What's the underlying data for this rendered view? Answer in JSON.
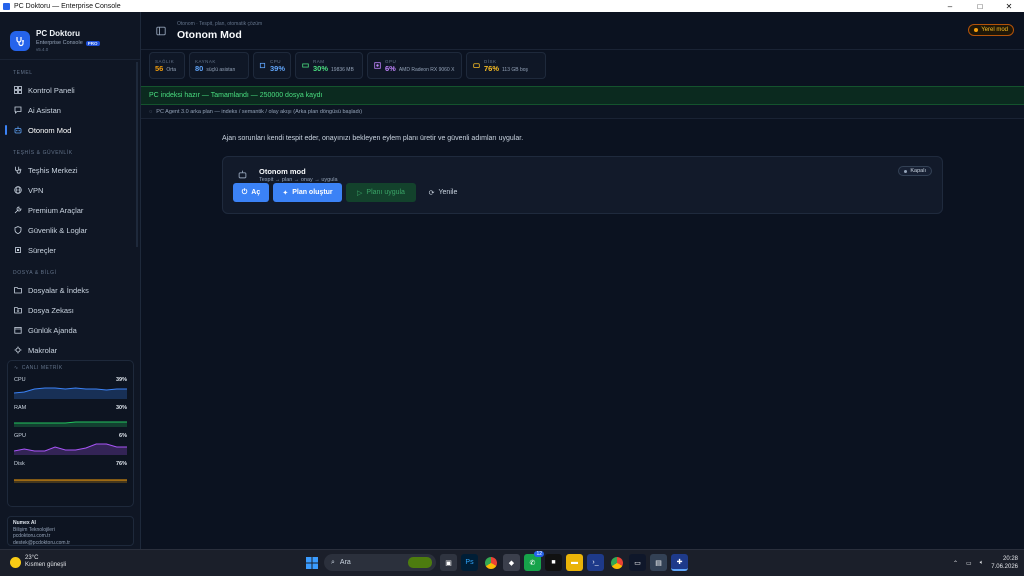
{
  "window": {
    "title": "PC Doktoru — Enterprise Console",
    "controls": [
      "–",
      "□",
      "✕"
    ]
  },
  "brand": {
    "name": "PC Doktoru",
    "subtitle": "Enterprise Console",
    "badge": "PRO",
    "version": "v5.4.0"
  },
  "sidebar": {
    "sections": [
      {
        "label": "TEMEL",
        "items": [
          {
            "label": "Kontrol Paneli",
            "icon": "grid-icon"
          },
          {
            "label": "Ai Asistan",
            "icon": "chat-icon"
          },
          {
            "label": "Otonom Mod",
            "icon": "robot-icon",
            "active": true
          }
        ]
      },
      {
        "label": "TEŞHİS & GÜVENLİK",
        "items": [
          {
            "label": "Teşhis Merkezi",
            "icon": "stethoscope-icon"
          },
          {
            "label": "VPN",
            "icon": "globe-icon"
          },
          {
            "label": "Premium Araçlar",
            "icon": "wrench-icon"
          },
          {
            "label": "Güvenlik & Loglar",
            "icon": "shield-icon"
          },
          {
            "label": "Süreçler",
            "icon": "cpu-icon"
          }
        ]
      },
      {
        "label": "DOSYA & BİLGİ",
        "items": [
          {
            "label": "Dosyalar & İndeks",
            "icon": "folder-icon"
          },
          {
            "label": "Dosya Zekası",
            "icon": "folder-search-icon"
          },
          {
            "label": "Günlük Ajanda",
            "icon": "calendar-icon"
          },
          {
            "label": "Makrolar",
            "icon": "macro-icon"
          }
        ]
      }
    ],
    "metrics": {
      "title": "CANLI METRİK",
      "rows": [
        {
          "label": "CPU",
          "value": "39%",
          "color": "#3b82f6",
          "points": [
            5,
            6,
            9,
            10,
            10,
            9,
            10,
            9,
            9,
            8,
            9,
            9
          ]
        },
        {
          "label": "RAM",
          "value": "30%",
          "color": "#22c55e",
          "points": [
            3,
            3,
            3,
            3,
            3,
            3,
            4,
            4,
            4,
            4,
            4,
            4
          ]
        },
        {
          "label": "GPU",
          "value": "6%",
          "color": "#a855f7",
          "points": [
            3,
            5,
            3,
            3,
            7,
            4,
            4,
            6,
            10,
            10,
            7,
            7
          ]
        },
        {
          "label": "Disk",
          "value": "76%",
          "color": "#f59e0b",
          "points": [
            2,
            2,
            2,
            2,
            2,
            2,
            2,
            2,
            2,
            2,
            2,
            2
          ]
        }
      ]
    },
    "company": {
      "name": "Numex AI",
      "lines": [
        "Bilişim Teknolojileri",
        "pcdoktoru.com.tr",
        "destek@pcdoktoru.com.tr"
      ]
    }
  },
  "header": {
    "breadcrumb": "Otonom · Tespit, plan, otomatik çözüm",
    "title": "Otonom Mod",
    "badge": "Yerel mod"
  },
  "stats": [
    {
      "label": "SAĞLIK",
      "value": "56",
      "sub": "Orta",
      "color": "#f59e0b",
      "icon": ""
    },
    {
      "label": "KAYNAK",
      "value": "80",
      "sub": "süçlü asistan",
      "color": "#60a5fa",
      "icon": ""
    },
    {
      "label": "CPU",
      "value": "39%",
      "sub": "",
      "color": "#60a5fa",
      "icon": "cpu-icon"
    },
    {
      "label": "RAM",
      "value": "30%",
      "sub": "19836 MB",
      "color": "#4ade80",
      "icon": "ram-icon"
    },
    {
      "label": "GPU",
      "value": "6%",
      "sub": "AMD Radeon RX 9060 X",
      "color": "#c084fc",
      "icon": "gpu-icon"
    },
    {
      "label": "DİSK",
      "value": "76%",
      "sub": "113 GB boş",
      "color": "#fbbf24",
      "icon": "disk-icon"
    }
  ],
  "banner": "PC indeksi hazır — Tamamlandı — 250000 dosya kaydı",
  "agent_line": "PC Agent 3.0 arka plan — indeks / semantik / olay akışı (Arka plan döngüsü başladı)",
  "intro": "Ajan sorunları kendi tespit eder, onayınızı bekleyen eylem planı üretir ve güvenli adımları uygular.",
  "card": {
    "title": "Otonom mod",
    "subtitle": "Tespit → plan → onay → uygula",
    "state": "Kapalı",
    "buttons": {
      "open": "Aç",
      "plan": "Plan oluştur",
      "apply": "Planı uygula",
      "refresh": "Yenile"
    }
  },
  "taskbar": {
    "weather_temp": "23°C",
    "weather_desc": "Kısmen güneşli",
    "search_placeholder": "Ara",
    "time": "20:28",
    "date": "7.06.2026",
    "chat_badge": "12"
  }
}
